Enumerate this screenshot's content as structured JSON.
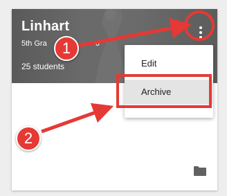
{
  "card": {
    "title": "Linhart",
    "subtitle": "5th Gra",
    "subtitle_tail": "6",
    "student_count": "25 students",
    "more_icon": "more-vert-icon",
    "folder_icon": "folder-icon"
  },
  "menu": {
    "items": [
      {
        "label": "Edit"
      },
      {
        "label": "Archive"
      }
    ]
  },
  "annotations": {
    "step1": "1",
    "step2": "2",
    "color": "#e53935"
  }
}
